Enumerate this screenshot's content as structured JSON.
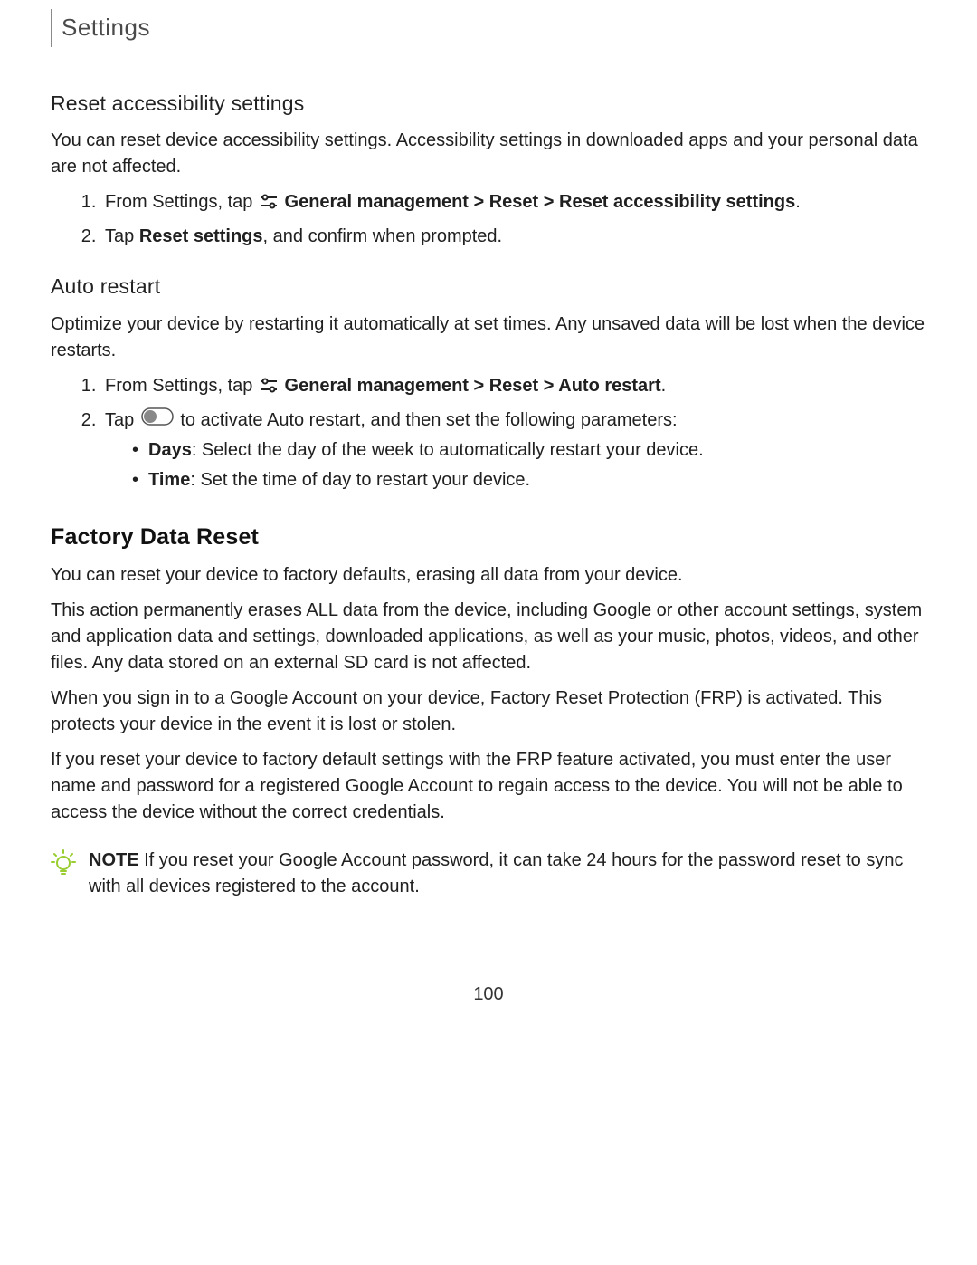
{
  "header": {
    "title": "Settings"
  },
  "section1": {
    "heading": "Reset accessibility settings",
    "intro": "You can reset device accessibility settings. Accessibility settings in downloaded apps and your personal data are not affected.",
    "step1_prefix": "From Settings, tap ",
    "step1_bold": "General management > Reset > Reset accessibility settings",
    "step1_suffix": ".",
    "step2_prefix": "Tap ",
    "step2_bold": "Reset settings",
    "step2_suffix": ", and confirm when prompted."
  },
  "section2": {
    "heading": "Auto restart",
    "intro": "Optimize your device by restarting it automatically at set times. Any unsaved data will be lost when the device restarts.",
    "step1_prefix": "From Settings, tap ",
    "step1_bold": "General management > Reset > Auto restart",
    "step1_suffix": ".",
    "step2_prefix": "Tap ",
    "step2_suffix": " to activate Auto restart, and then set the following parameters:",
    "bullet1_bold": "Days",
    "bullet1_text": ": Select the day of the week to automatically restart your device.",
    "bullet2_bold": "Time",
    "bullet2_text": ": Set the time of day to restart your device."
  },
  "section3": {
    "heading": "Factory Data Reset",
    "p1": "You can reset your device to factory defaults, erasing all data from your device.",
    "p2": "This action permanently erases ALL data from the device, including Google or other account settings, system and application data and settings, downloaded applications, as well as your music, photos, videos, and other files. Any data stored on an external SD card is not affected.",
    "p3": "When you sign in to a Google Account on your device, Factory Reset Protection (FRP) is activated. This protects your device in the event it is lost or stolen.",
    "p4": "If you reset your device to factory default settings with the FRP feature activated, you must enter the user name and password for a registered Google Account to regain access to the device. You will not be able to access the device without the correct credentials."
  },
  "note": {
    "label": "NOTE",
    "text": "If you reset your Google Account password, it can take 24 hours for the password reset to sync with all devices registered to the account."
  },
  "page_number": "100"
}
